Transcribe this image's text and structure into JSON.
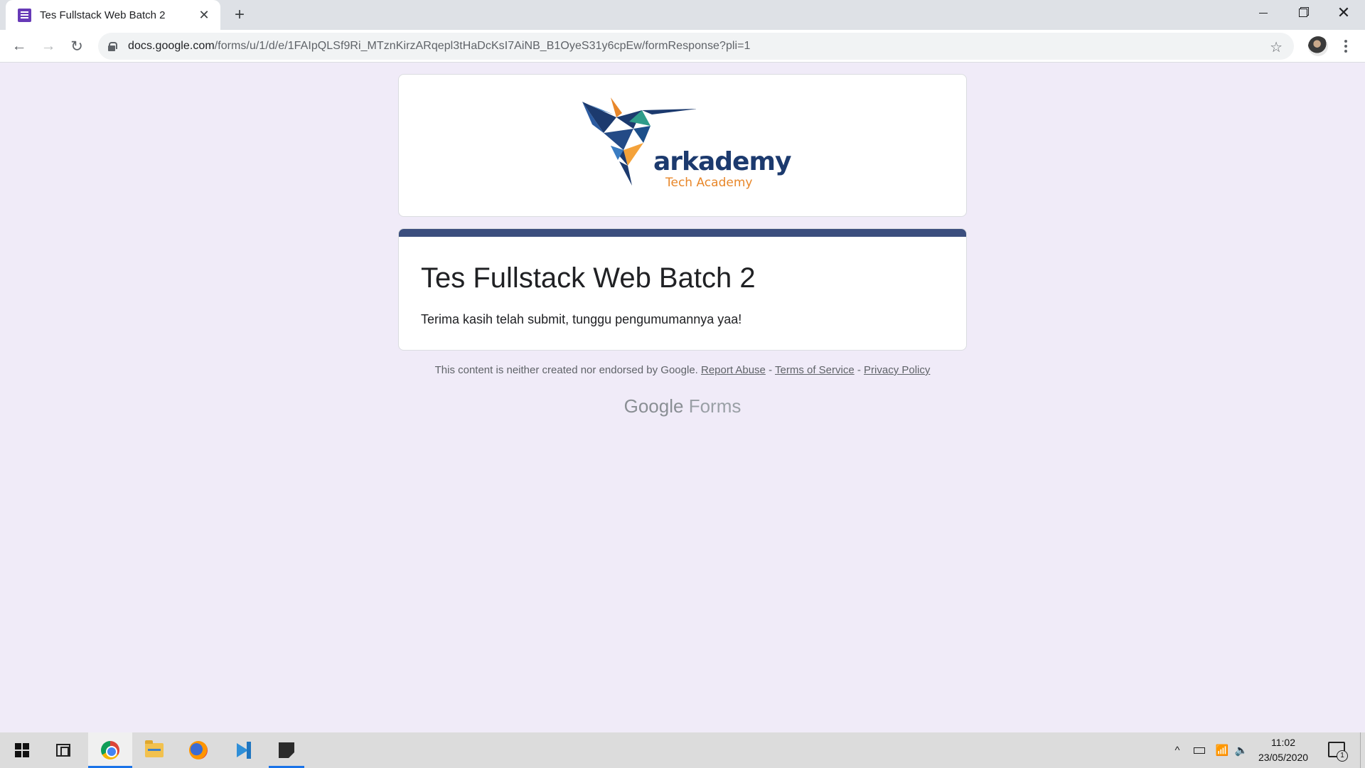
{
  "browser": {
    "tab_title": "Tes Fullstack Web Batch 2",
    "tab_close": "✕",
    "new_tab": "+",
    "window_close": "✕",
    "url_host": "docs.google.com",
    "url_path": "/forms/u/1/d/e/1FAIpQLSf9Ri_MTznKirzARqepl3tHaDcKsI7AiNB_B1OyeS31y6cpEw/formResponse?pli=1",
    "back_icon": "←",
    "forward_icon": "→",
    "reload_icon": "↻",
    "star_icon": "☆"
  },
  "page": {
    "logo_word": "arkademy",
    "logo_sub": "Tech Academy",
    "form_title": "Tes Fullstack Web Batch 2",
    "confirmation": "Terima kasih telah submit, tunggu pengumumannya yaa!",
    "disclaimer_text": "This content is neither created nor endorsed by Google.",
    "report_abuse": "Report Abuse",
    "terms": "Terms of Service",
    "privacy": "Privacy Policy",
    "sep": "-",
    "footer_google": "Google",
    "footer_forms": "Forms",
    "accent_color": "#3b4e7e",
    "background_color": "#f0ebf8"
  },
  "taskbar": {
    "time": "11:02",
    "date": "23/05/2020",
    "notif_count": "1",
    "tray_chevron": "^",
    "volume_icon": "🔈",
    "wifi_icon": "📶"
  }
}
